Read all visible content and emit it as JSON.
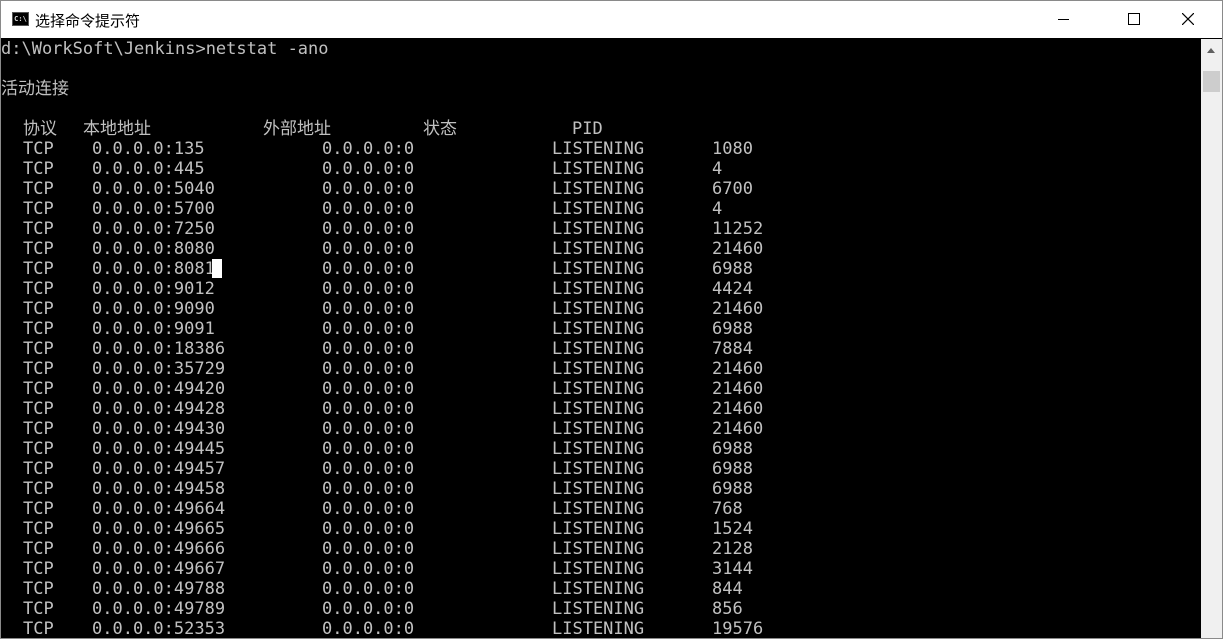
{
  "window": {
    "title": "选择命令提示符",
    "icon": "cmd-icon",
    "controls": [
      "minimize-icon",
      "maximize-icon",
      "close-icon"
    ]
  },
  "console": {
    "prompt_line": "d:\\WorkSoft\\Jenkins>netstat -ano",
    "section_title": "活动连接",
    "headers": {
      "protocol": "协议",
      "local": "本地地址",
      "foreign": "外部地址",
      "state": "状态",
      "pid": "PID"
    },
    "rows": [
      {
        "proto": "TCP",
        "local": "0.0.0.0:135",
        "foreign": "0.0.0.0:0",
        "state": "LISTENING",
        "pid": "1080"
      },
      {
        "proto": "TCP",
        "local": "0.0.0.0:445",
        "foreign": "0.0.0.0:0",
        "state": "LISTENING",
        "pid": "4"
      },
      {
        "proto": "TCP",
        "local": "0.0.0.0:5040",
        "foreign": "0.0.0.0:0",
        "state": "LISTENING",
        "pid": "6700"
      },
      {
        "proto": "TCP",
        "local": "0.0.0.0:5700",
        "foreign": "0.0.0.0:0",
        "state": "LISTENING",
        "pid": "4"
      },
      {
        "proto": "TCP",
        "local": "0.0.0.0:7250",
        "foreign": "0.0.0.0:0",
        "state": "LISTENING",
        "pid": "11252"
      },
      {
        "proto": "TCP",
        "local": "0.0.0.0:8080",
        "foreign": "0.0.0.0:0",
        "state": "LISTENING",
        "pid": "21460"
      },
      {
        "proto": "TCP",
        "local": "0.0.0.0:8081",
        "foreign": "0.0.0.0:0",
        "state": "LISTENING",
        "pid": "6988"
      },
      {
        "proto": "TCP",
        "local": "0.0.0.0:9012",
        "foreign": "0.0.0.0:0",
        "state": "LISTENING",
        "pid": "4424"
      },
      {
        "proto": "TCP",
        "local": "0.0.0.0:9090",
        "foreign": "0.0.0.0:0",
        "state": "LISTENING",
        "pid": "21460"
      },
      {
        "proto": "TCP",
        "local": "0.0.0.0:9091",
        "foreign": "0.0.0.0:0",
        "state": "LISTENING",
        "pid": "6988"
      },
      {
        "proto": "TCP",
        "local": "0.0.0.0:18386",
        "foreign": "0.0.0.0:0",
        "state": "LISTENING",
        "pid": "7884"
      },
      {
        "proto": "TCP",
        "local": "0.0.0.0:35729",
        "foreign": "0.0.0.0:0",
        "state": "LISTENING",
        "pid": "21460"
      },
      {
        "proto": "TCP",
        "local": "0.0.0.0:49420",
        "foreign": "0.0.0.0:0",
        "state": "LISTENING",
        "pid": "21460"
      },
      {
        "proto": "TCP",
        "local": "0.0.0.0:49428",
        "foreign": "0.0.0.0:0",
        "state": "LISTENING",
        "pid": "21460"
      },
      {
        "proto": "TCP",
        "local": "0.0.0.0:49430",
        "foreign": "0.0.0.0:0",
        "state": "LISTENING",
        "pid": "21460"
      },
      {
        "proto": "TCP",
        "local": "0.0.0.0:49445",
        "foreign": "0.0.0.0:0",
        "state": "LISTENING",
        "pid": "6988"
      },
      {
        "proto": "TCP",
        "local": "0.0.0.0:49457",
        "foreign": "0.0.0.0:0",
        "state": "LISTENING",
        "pid": "6988"
      },
      {
        "proto": "TCP",
        "local": "0.0.0.0:49458",
        "foreign": "0.0.0.0:0",
        "state": "LISTENING",
        "pid": "6988"
      },
      {
        "proto": "TCP",
        "local": "0.0.0.0:49664",
        "foreign": "0.0.0.0:0",
        "state": "LISTENING",
        "pid": "768"
      },
      {
        "proto": "TCP",
        "local": "0.0.0.0:49665",
        "foreign": "0.0.0.0:0",
        "state": "LISTENING",
        "pid": "1524"
      },
      {
        "proto": "TCP",
        "local": "0.0.0.0:49666",
        "foreign": "0.0.0.0:0",
        "state": "LISTENING",
        "pid": "2128"
      },
      {
        "proto": "TCP",
        "local": "0.0.0.0:49667",
        "foreign": "0.0.0.0:0",
        "state": "LISTENING",
        "pid": "3144"
      },
      {
        "proto": "TCP",
        "local": "0.0.0.0:49788",
        "foreign": "0.0.0.0:0",
        "state": "LISTENING",
        "pid": "844"
      },
      {
        "proto": "TCP",
        "local": "0.0.0.0:49789",
        "foreign": "0.0.0.0:0",
        "state": "LISTENING",
        "pid": "856"
      },
      {
        "proto": "TCP",
        "local": "0.0.0.0:52353",
        "foreign": "0.0.0.0:0",
        "state": "LISTENING",
        "pid": "19576"
      }
    ]
  }
}
